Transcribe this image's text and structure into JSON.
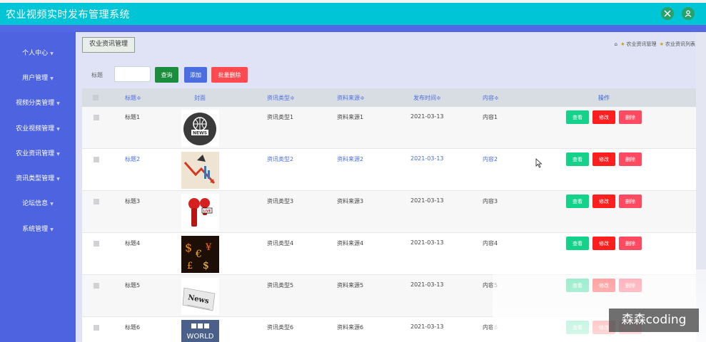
{
  "app": {
    "title": "农业视频实时发布管理系统"
  },
  "sidebar": {
    "items": [
      {
        "label": "个人中心"
      },
      {
        "label": "用户管理"
      },
      {
        "label": "视频分类管理"
      },
      {
        "label": "农业视频管理"
      },
      {
        "label": "农业资讯管理"
      },
      {
        "label": "资讯类型管理"
      },
      {
        "label": "论坛信息"
      },
      {
        "label": "系统管理"
      }
    ]
  },
  "page": {
    "tab": "农业资讯管理",
    "breadcrumb": [
      "农业资讯管理",
      "农业资讯列表"
    ]
  },
  "search": {
    "label": "标题",
    "value": "",
    "query_label": "查询",
    "add_label": "添加",
    "batch_delete_label": "批量删除"
  },
  "table": {
    "headers": {
      "title": "标题≑",
      "cover": "封面",
      "type": "资讯类型≑",
      "source": "资料来源≑",
      "date": "发布时间≑",
      "content": "内容≑",
      "ops": "操作"
    },
    "op_labels": {
      "view": "查看",
      "edit": "修改",
      "delete": "删除"
    },
    "rows": [
      {
        "title": "标题1",
        "cover": "news-globe-image",
        "type": "资讯类型1",
        "source": "资料来源1",
        "date": "2021-03-13",
        "content": "内容1"
      },
      {
        "title": "标题2",
        "cover": "chart-arrow-image",
        "type": "资讯类型2",
        "source": "资料来源2",
        "date": "2021-03-13",
        "content": "内容2"
      },
      {
        "title": "标题3",
        "cover": "live-microphone-image",
        "type": "资讯类型3",
        "source": "资料来源3",
        "date": "2021-03-13",
        "content": "内容3"
      },
      {
        "title": "标题4",
        "cover": "currency-symbols-image",
        "type": "资讯类型4",
        "source": "资料来源4",
        "date": "2021-03-13",
        "content": "内容4"
      },
      {
        "title": "标题5",
        "cover": "newspaper-image",
        "type": "资讯类型5",
        "source": "资料来源5",
        "date": "2021-03-13",
        "content": "内容5"
      },
      {
        "title": "标题6",
        "cover": "bbc-world-image",
        "type": "资讯类型6",
        "source": "资料来源6",
        "date": "2021-03-13",
        "content": "内容6"
      }
    ]
  },
  "watermark": {
    "text": "森森coding"
  },
  "colors": {
    "topbar": "#00c5d6",
    "sidebar": "#4e63e0",
    "view": "#14d28a",
    "edit": "#ff1f1f",
    "delete": "#ff4a62"
  }
}
